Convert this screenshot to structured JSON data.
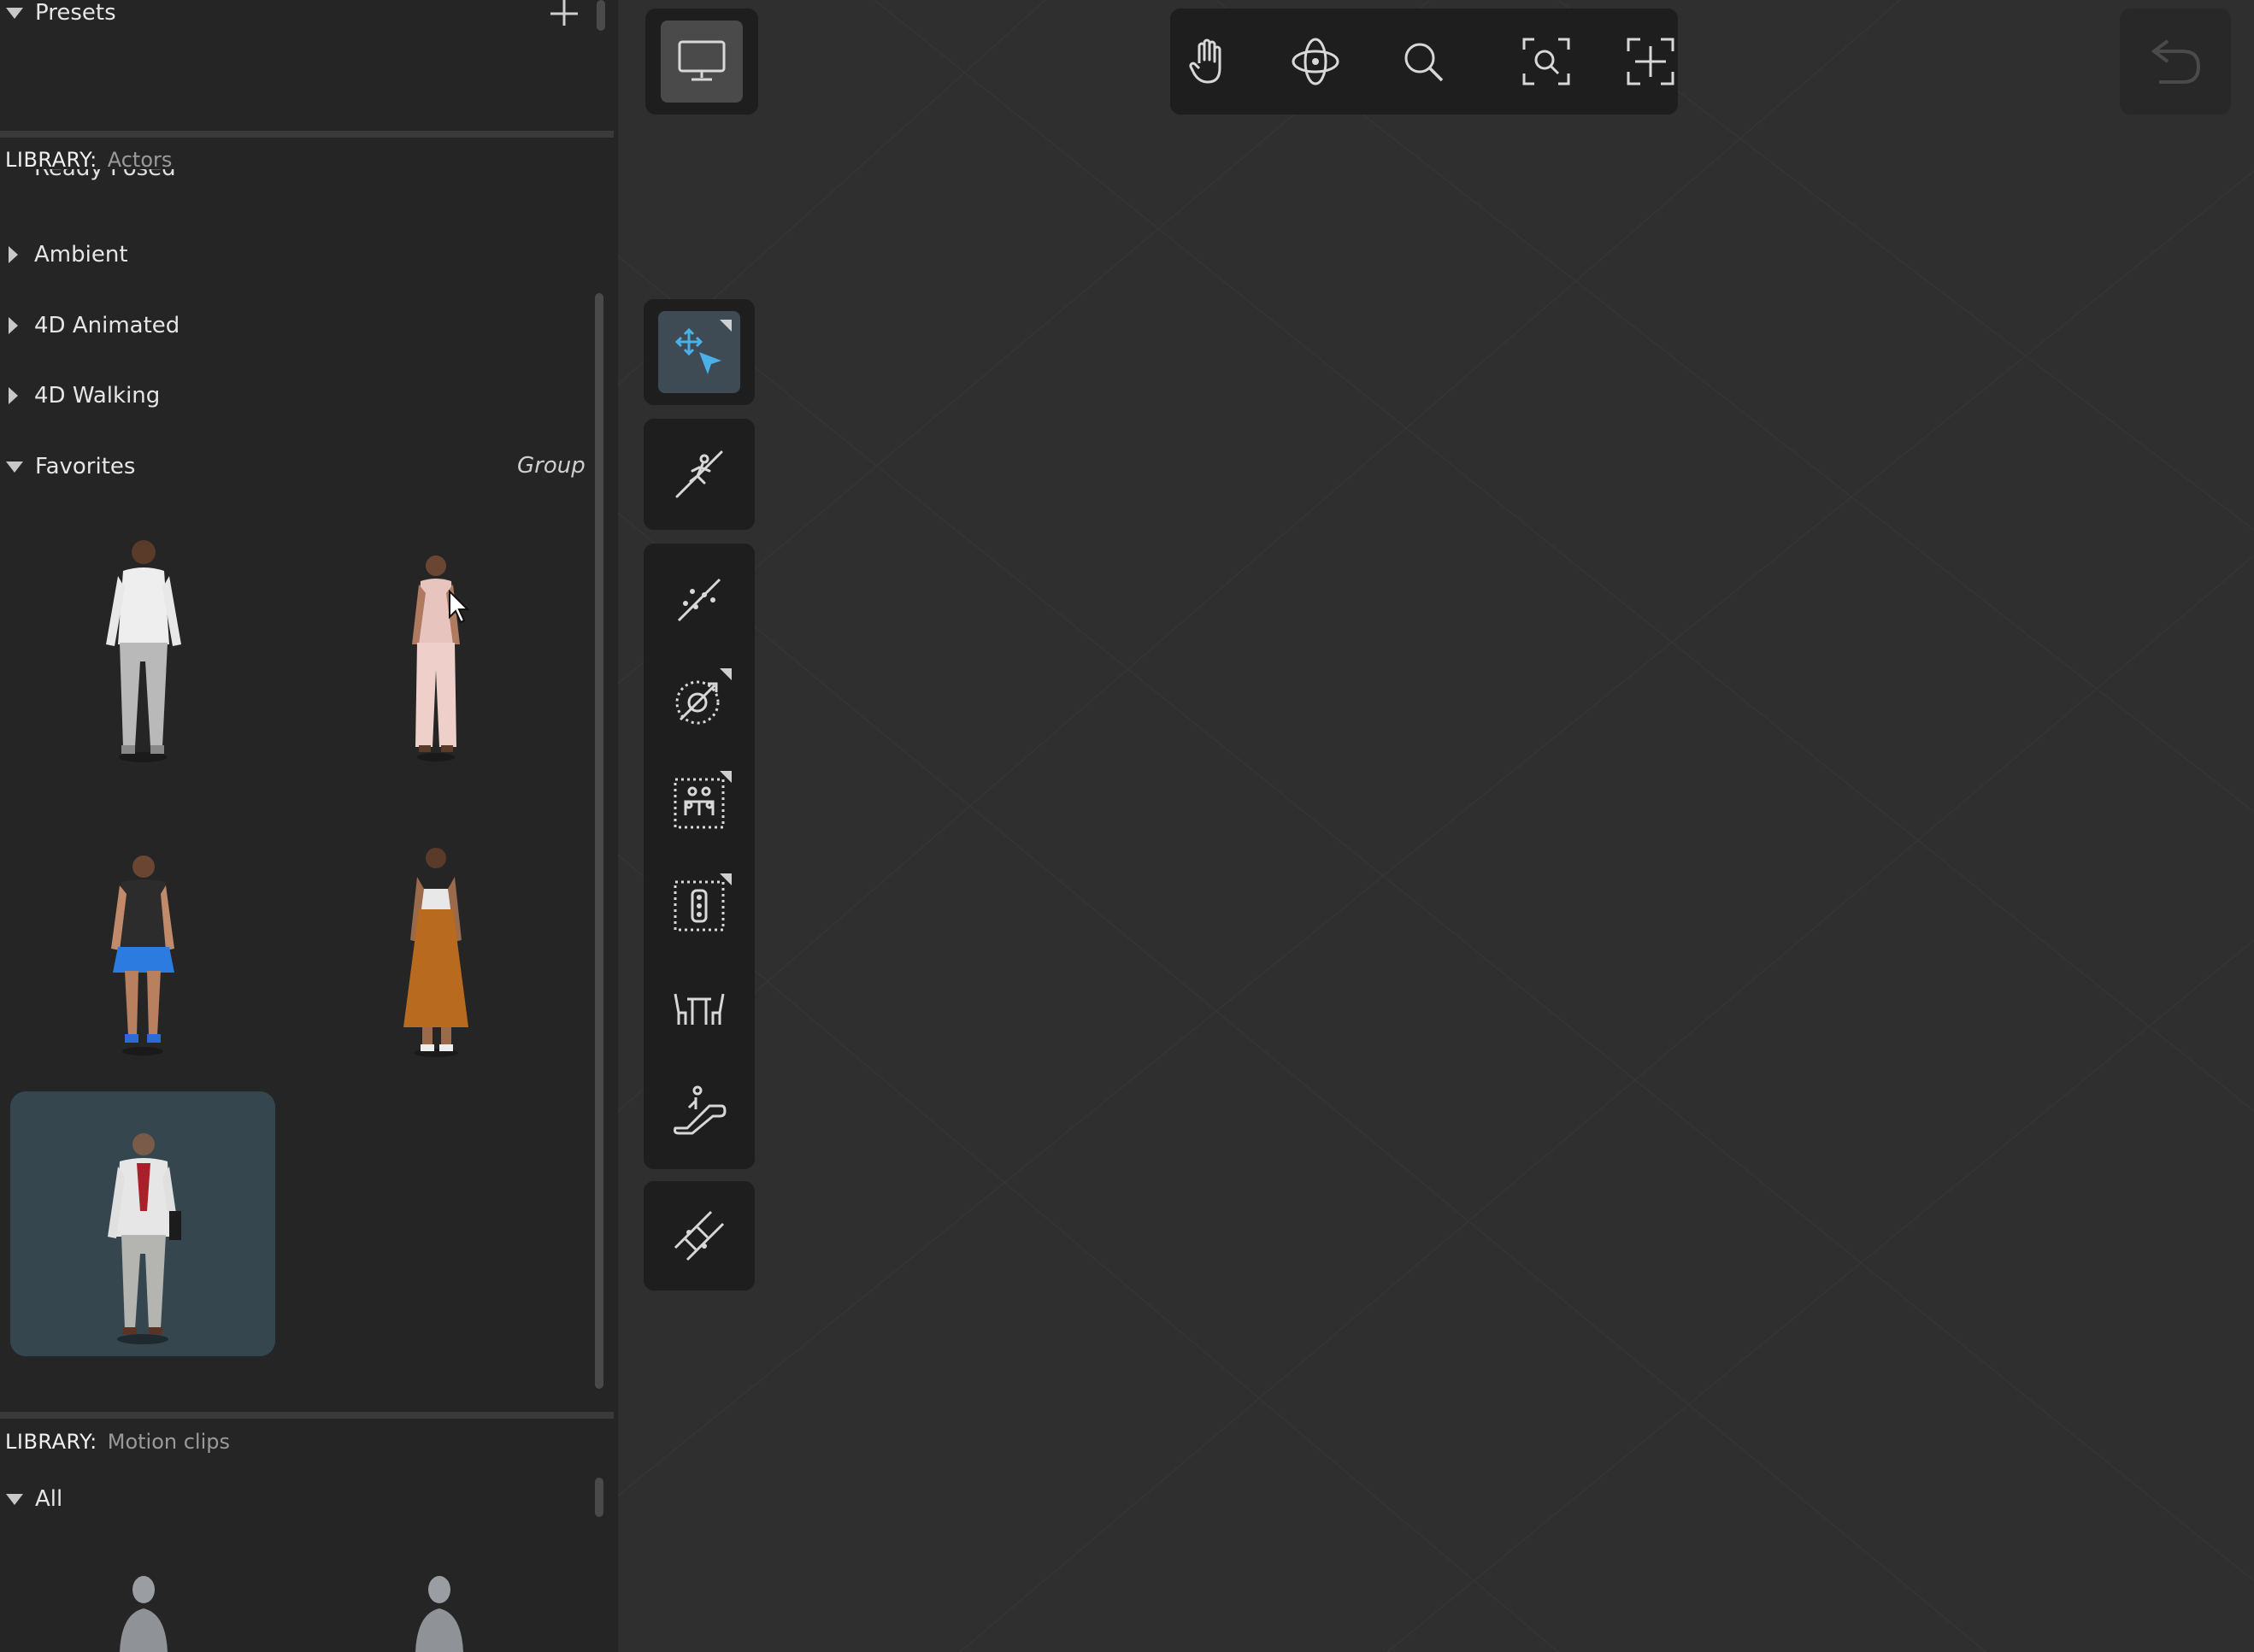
{
  "presets": {
    "label": "Presets"
  },
  "actors_library": {
    "label": "LIBRARY:",
    "name": "Actors",
    "partial_item": "Ready Posed",
    "categories": [
      {
        "label": "Ambient",
        "expanded": false
      },
      {
        "label": "4D Animated",
        "expanded": false
      },
      {
        "label": "4D Walking",
        "expanded": false
      }
    ],
    "favorites": {
      "label": "Favorites",
      "action": "Group"
    }
  },
  "motion_library": {
    "label": "LIBRARY:",
    "name": "Motion clips",
    "all_label": "All"
  },
  "colors": {
    "accent": "#4ab0e8",
    "panel_bg": "#252525",
    "viewport_bg": "#2f2f2f",
    "selected_thumb": "#35464f"
  }
}
